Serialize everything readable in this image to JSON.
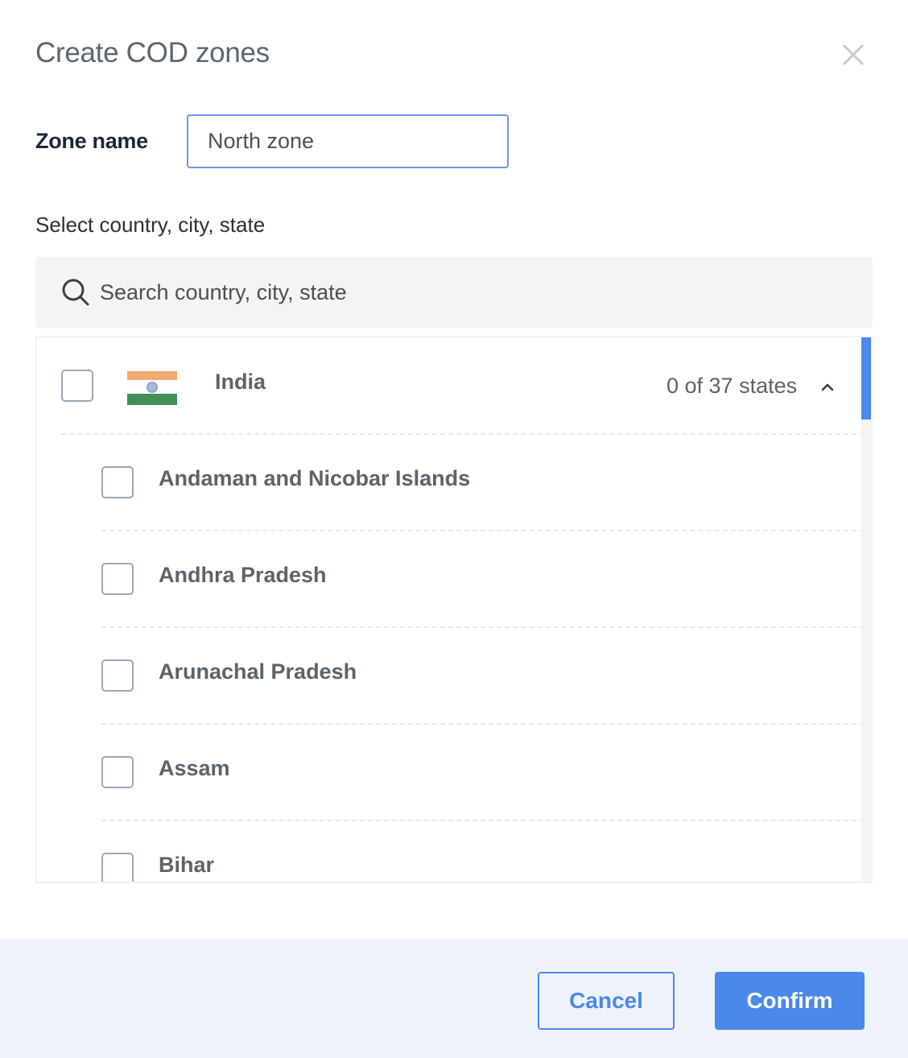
{
  "dialog": {
    "title": "Create COD zones",
    "close_icon": "close-icon"
  },
  "zone_name": {
    "label": "Zone name",
    "value": "North zone"
  },
  "selector": {
    "label": "Select country, city, state",
    "search_placeholder": "Search country, city, state",
    "search_icon": "search-icon"
  },
  "country": {
    "name": "India",
    "flag": "india-flag-icon",
    "checked": false,
    "states_summary": "0 of 37 states",
    "expanded": true,
    "toggle_icon": "chevron-up-icon"
  },
  "states": [
    {
      "name": "Andaman and Nicobar Islands",
      "checked": false
    },
    {
      "name": "Andhra Pradesh",
      "checked": false
    },
    {
      "name": "Arunachal Pradesh",
      "checked": false
    },
    {
      "name": "Assam",
      "checked": false
    },
    {
      "name": "Bihar",
      "checked": false
    }
  ],
  "footer": {
    "cancel_label": "Cancel",
    "confirm_label": "Confirm"
  },
  "colors": {
    "accent": "#4a88ea",
    "footer_bg": "#eef2fb",
    "search_bg": "#f4f4f4",
    "saffron": "#eeaa72",
    "green": "#438f58"
  }
}
